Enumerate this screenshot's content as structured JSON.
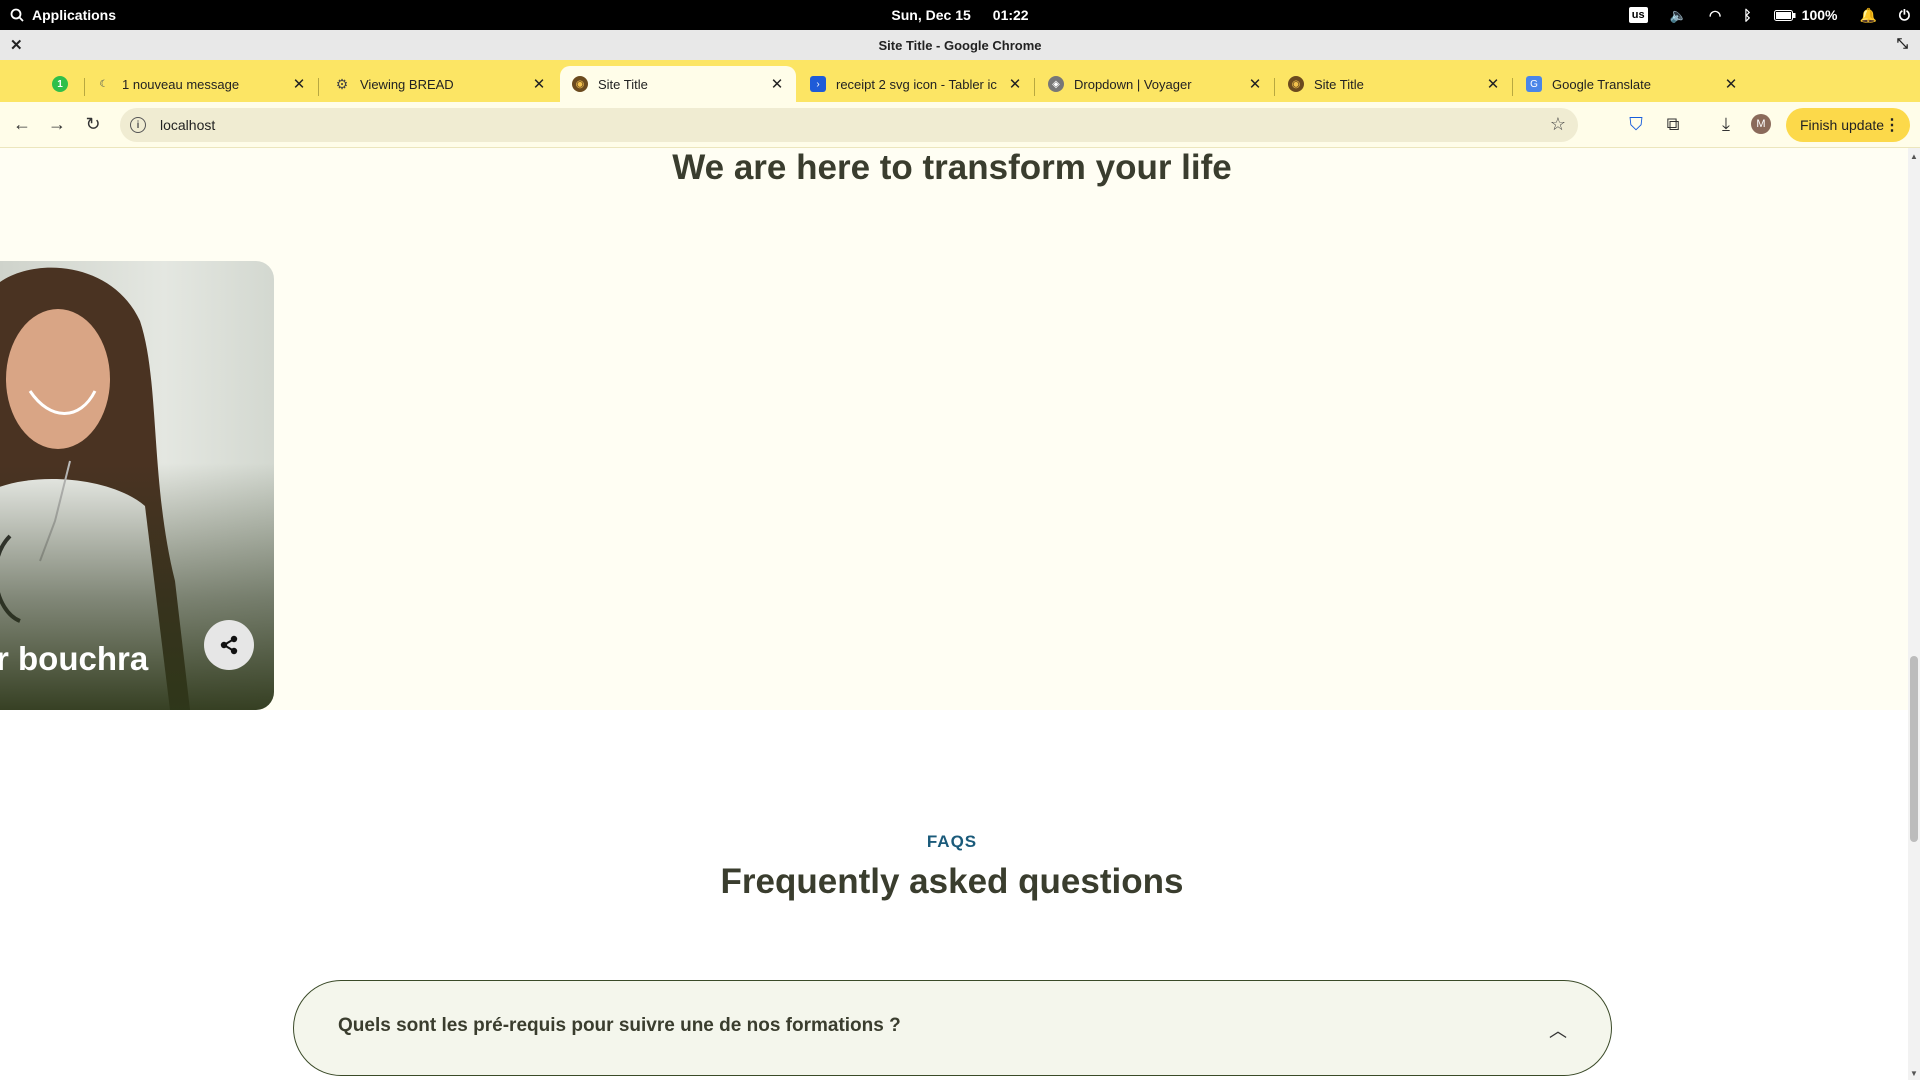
{
  "system_bar": {
    "apps_label": "Applications",
    "date": "Sun, Dec 15",
    "time": "01:22",
    "keyboard_layout": "us",
    "battery": "100%"
  },
  "window": {
    "title": "Site Title - Google Chrome"
  },
  "tabs": [
    {
      "label": "1 nouveau message"
    },
    {
      "label": "Viewing BREAD"
    },
    {
      "label": "Site Title"
    },
    {
      "label": "receipt 2 svg icon - Tabler ic"
    },
    {
      "label": "Dropdown | Voyager"
    },
    {
      "label": "Site Title"
    },
    {
      "label": "Google Translate"
    }
  ],
  "pinned_tab_badge": "1",
  "toolbar": {
    "url": "localhost",
    "finish_update": "Finish update",
    "profile_initial": "M"
  },
  "hero": {
    "title": "We are here to transform your life",
    "card_name": "r bouchra"
  },
  "faq": {
    "eyebrow": "FAQS",
    "title": "Frequently asked questions",
    "items": [
      {
        "question": "Quels sont les pré-requis pour suivre une de nos formations ?"
      }
    ]
  }
}
